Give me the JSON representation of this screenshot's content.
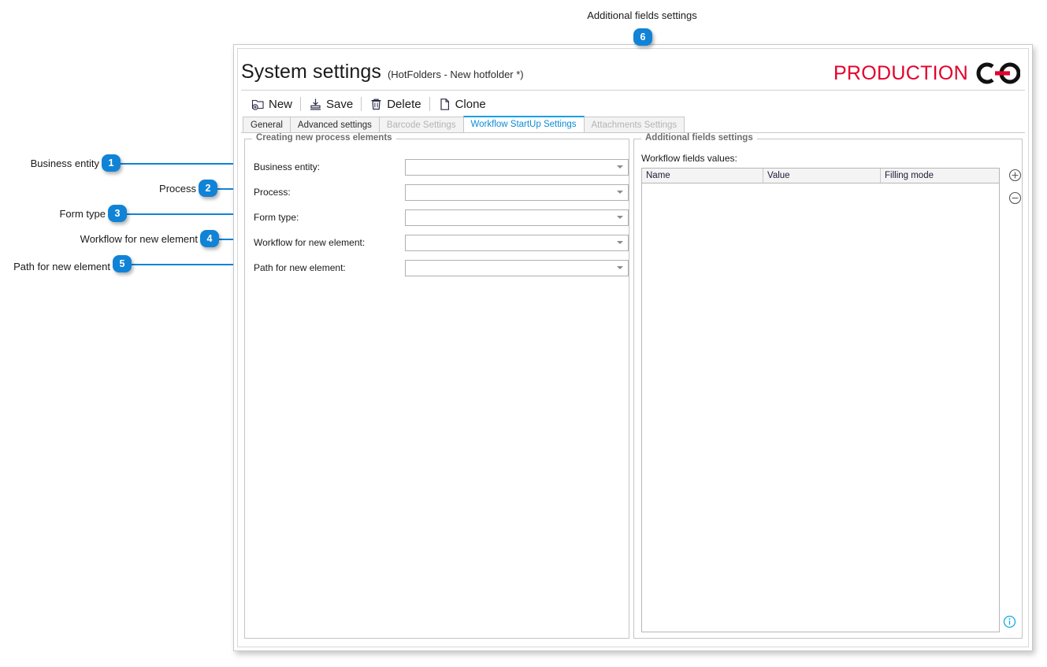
{
  "window": {
    "title": "System settings",
    "subtitle": "(HotFolders - New hotfolder *)",
    "brand": "PRODUCTION",
    "brand_color": "#e3002b",
    "accent_color": "#1183d6"
  },
  "toolbar": {
    "items": [
      {
        "label": "New",
        "icon": "new-folder-icon"
      },
      {
        "label": "Save",
        "icon": "save-icon"
      },
      {
        "label": "Delete",
        "icon": "trash-icon"
      },
      {
        "label": "Clone",
        "icon": "copy-page-icon"
      }
    ]
  },
  "tabs": [
    {
      "label": "General",
      "state": "normal"
    },
    {
      "label": "Advanced settings",
      "state": "normal"
    },
    {
      "label": "Barcode Settings",
      "state": "disabled"
    },
    {
      "label": "Workflow StartUp Settings",
      "state": "active"
    },
    {
      "label": "Attachments Settings",
      "state": "disabled"
    }
  ],
  "left_panel": {
    "title": "Creating new process elements",
    "fields": [
      {
        "label": "Business entity:",
        "value": "",
        "placeholder": ""
      },
      {
        "label": "Process:",
        "value": "",
        "placeholder": ""
      },
      {
        "label": "Form type:",
        "value": "",
        "placeholder": ""
      },
      {
        "label": "Workflow for new element:",
        "value": "",
        "placeholder": ""
      },
      {
        "label": "Path for new element:",
        "value": "",
        "placeholder": ""
      }
    ]
  },
  "right_panel": {
    "title": "Additional fields settings",
    "grid_caption": "Workflow fields values:",
    "grid": {
      "columns": [
        "Name",
        "Value",
        "Filling mode"
      ],
      "rows": []
    },
    "tools": [
      {
        "name": "add-row-button",
        "icon": "plus-circle-icon"
      },
      {
        "name": "remove-row-button",
        "icon": "minus-circle-icon"
      }
    ],
    "info": {
      "icon": "info-circle-icon"
    }
  },
  "callouts": [
    {
      "n": "1",
      "label": "Business entity"
    },
    {
      "n": "2",
      "label": "Process"
    },
    {
      "n": "3",
      "label": "Form type"
    },
    {
      "n": "4",
      "label": "Workflow for new element"
    },
    {
      "n": "5",
      "label": "Path for new element"
    },
    {
      "n": "6",
      "label": "Additional fields settings"
    }
  ]
}
